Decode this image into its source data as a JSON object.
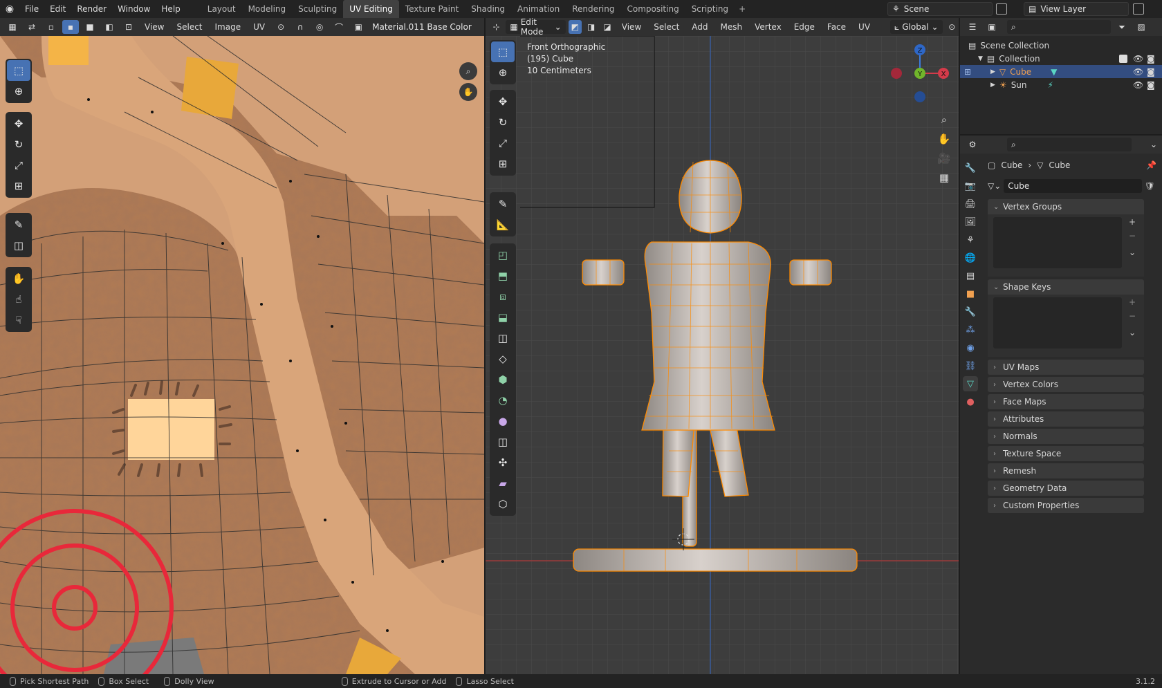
{
  "app": {
    "menu": [
      "File",
      "Edit",
      "Render",
      "Window",
      "Help"
    ],
    "workspace_tabs": [
      "Layout",
      "Modeling",
      "Sculpting",
      "UV Editing",
      "Texture Paint",
      "Shading",
      "Animation",
      "Rendering",
      "Compositing",
      "Scripting"
    ],
    "active_tab": "UV Editing",
    "scene": "Scene",
    "view_layer": "View Layer"
  },
  "uv_editor": {
    "menu": [
      "View",
      "Select",
      "Image",
      "UV"
    ],
    "image_name": "Material.011 Base Color"
  },
  "viewport": {
    "mode": "Edit Mode",
    "menu": [
      "View",
      "Select",
      "Add",
      "Mesh",
      "Vertex",
      "Edge",
      "Face",
      "UV"
    ],
    "orientation": "Global",
    "overlay_line1": "Front Orthographic",
    "overlay_line2": "(195) Cube",
    "overlay_line3": "10 Centimeters",
    "gizmo": {
      "z": "Z",
      "y": "Y",
      "x": "X"
    }
  },
  "outliner": {
    "root": "Scene Collection",
    "collection": "Collection",
    "items": [
      {
        "name": "Cube",
        "icon": "mesh-icon",
        "selected": true
      },
      {
        "name": "Sun",
        "icon": "light-icon",
        "selected": false
      }
    ]
  },
  "properties": {
    "breadcrumb_object": "Cube",
    "breadcrumb_data": "Cube",
    "data_name": "Cube",
    "panels_open": [
      "Vertex Groups",
      "Shape Keys"
    ],
    "panels_closed": [
      "UV Maps",
      "Vertex Colors",
      "Face Maps",
      "Attributes",
      "Normals",
      "Texture Space",
      "Remesh",
      "Geometry Data",
      "Custom Properties"
    ]
  },
  "statusbar": {
    "items": [
      "Pick Shortest Path",
      "Box Select",
      "Dolly View",
      "Extrude to Cursor or Add",
      "Lasso Select"
    ],
    "version": "3.1.2"
  },
  "colors": {
    "accent": "#4772b3",
    "mesh_edge": "#ff8a00",
    "uv_path": "#d9a57a",
    "uv_patch": "#a97352"
  }
}
